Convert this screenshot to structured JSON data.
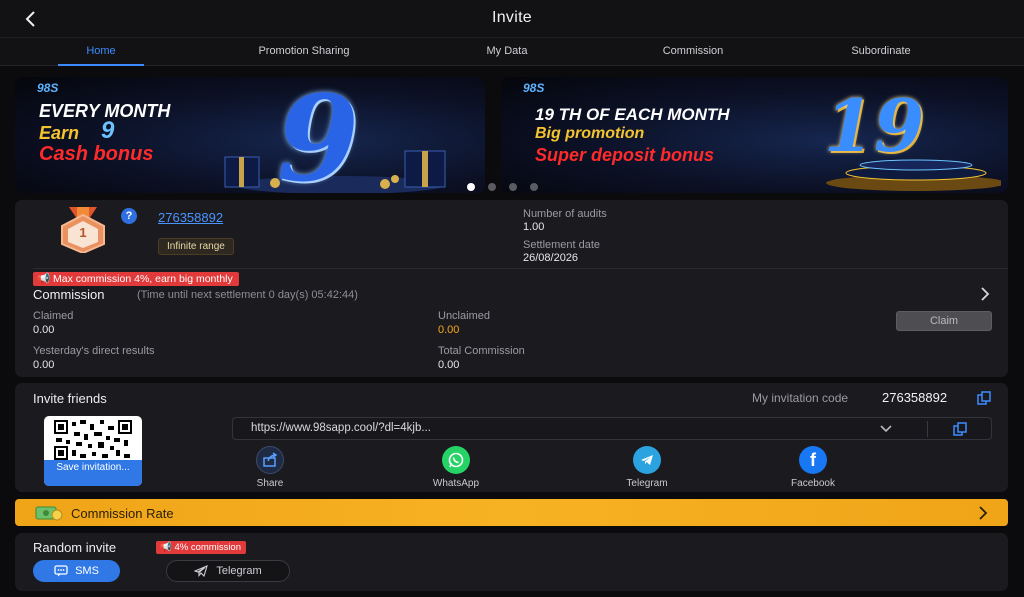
{
  "header": {
    "title": "Invite"
  },
  "tabs": [
    {
      "label": "Home",
      "active": true
    },
    {
      "label": "Promotion Sharing"
    },
    {
      "label": "My Data"
    },
    {
      "label": "Commission"
    },
    {
      "label": "Subordinate"
    }
  ],
  "banners": [
    {
      "logo": "98S",
      "lines": [
        "EVERY MONTH",
        "Earn",
        "9",
        "Cash bonus"
      ],
      "big_number": "9"
    },
    {
      "logo": "98S",
      "lines": [
        "19 TH  OF EACH MONTH",
        "Big promotion",
        "Super deposit bonus"
      ],
      "big_number": "19"
    }
  ],
  "carousel": {
    "count": 4,
    "active_index": 0
  },
  "agent": {
    "medal_rank": "1",
    "help_symbol": "?",
    "user_id": "276358892",
    "range_badge": "Infinite range",
    "audits_label": "Number of audits",
    "audits_value": "1.00",
    "settlement_label": "Settlement date",
    "settlement_value": "26/08/2026"
  },
  "commission": {
    "promo_badge": "Max commission 4%, earn big monthly",
    "title": "Commission",
    "countdown": "(Time until next settlement  0 day(s) 05:42:44)",
    "claimed_label": "Claimed",
    "claimed_value": "0.00",
    "unclaimed_label": "Unclaimed",
    "unclaimed_value": "0.00",
    "claim_button": "Claim",
    "yesterday_label": "Yesterday's direct results",
    "yesterday_value": "0.00",
    "total_label": "Total Commission",
    "total_value": "0.00"
  },
  "invite": {
    "title": "Invite friends",
    "code_label": "My invitation code",
    "code_value": "276358892",
    "qr_save_label": "Save invitation...",
    "link": "https://www.98sapp.cool/?dl=4kjb...",
    "share_options": [
      {
        "label": "Share",
        "icon": "share-icon"
      },
      {
        "label": "WhatsApp",
        "icon": "whatsapp-icon"
      },
      {
        "label": "Telegram",
        "icon": "telegram-icon"
      },
      {
        "label": "Facebook",
        "icon": "facebook-icon"
      }
    ]
  },
  "rate_bar": {
    "label": "Commission Rate"
  },
  "random_invite": {
    "title": "Random invite",
    "badge": "4% commission",
    "sms_label": "SMS",
    "telegram_label": "Telegram"
  },
  "colors": {
    "accent_blue": "#3d8bff",
    "unclaimed_orange": "#f2a81d",
    "rate_bar": "#f7b223",
    "badge_red": "#e23a3a",
    "background": "#0b0b0d",
    "card": "#1b1b1f"
  }
}
